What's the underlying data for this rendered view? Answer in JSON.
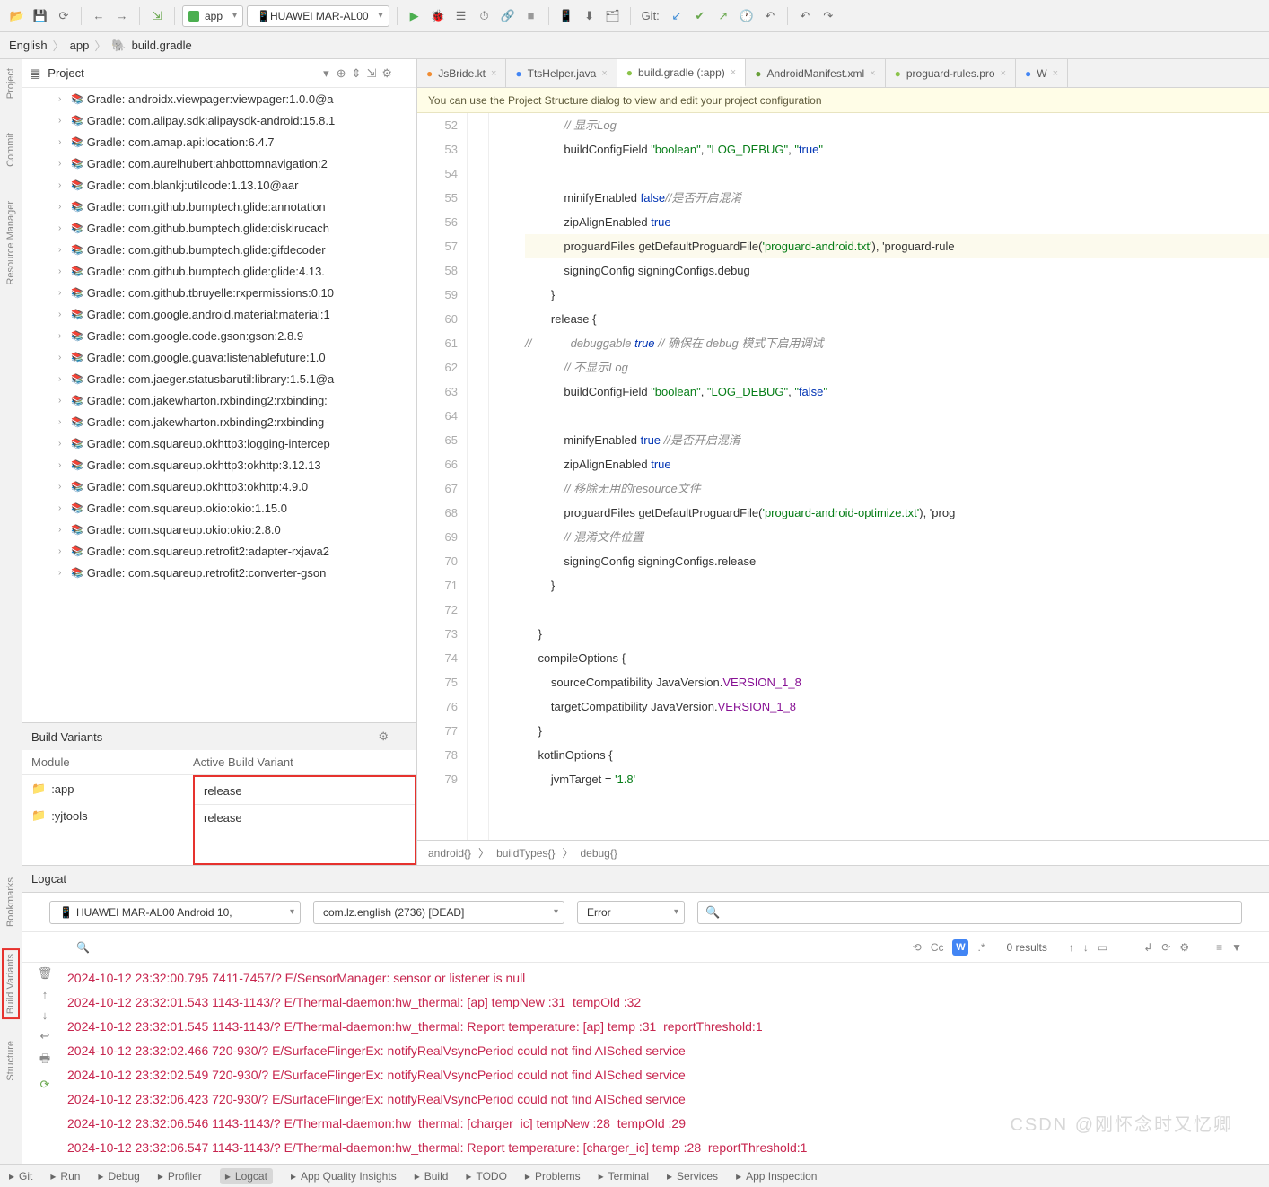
{
  "toolbar": {
    "run_config": "app",
    "device": "HUAWEI MAR-AL00",
    "vcs_label": "Git:"
  },
  "breadcrumb": {
    "root": "English",
    "mid": "app",
    "file": "build.gradle"
  },
  "left_rails": [
    "Project",
    "Commit",
    "Resource Manager"
  ],
  "project_panel": {
    "title": "Project"
  },
  "tree_items": [
    "Gradle: androidx.viewpager:viewpager:1.0.0@a",
    "Gradle: com.alipay.sdk:alipaysdk-android:15.8.1",
    "Gradle: com.amap.api:location:6.4.7",
    "Gradle: com.aurelhubert:ahbottomnavigation:2",
    "Gradle: com.blankj:utilcode:1.13.10@aar",
    "Gradle: com.github.bumptech.glide:annotation",
    "Gradle: com.github.bumptech.glide:disklrucach",
    "Gradle: com.github.bumptech.glide:gifdecoder",
    "Gradle: com.github.bumptech.glide:glide:4.13.",
    "Gradle: com.github.tbruyelle:rxpermissions:0.10",
    "Gradle: com.google.android.material:material:1",
    "Gradle: com.google.code.gson:gson:2.8.9",
    "Gradle: com.google.guava:listenablefuture:1.0",
    "Gradle: com.jaeger.statusbarutil:library:1.5.1@a",
    "Gradle: com.jakewharton.rxbinding2:rxbinding:",
    "Gradle: com.jakewharton.rxbinding2:rxbinding-",
    "Gradle: com.squareup.okhttp3:logging-intercep",
    "Gradle: com.squareup.okhttp3:okhttp:3.12.13",
    "Gradle: com.squareup.okhttp3:okhttp:4.9.0",
    "Gradle: com.squareup.okio:okio:1.15.0",
    "Gradle: com.squareup.okio:okio:2.8.0",
    "Gradle: com.squareup.retrofit2:adapter-rxjava2",
    "Gradle: com.squareup.retrofit2:converter-gson"
  ],
  "build_variants": {
    "title": "Build Variants",
    "col_module": "Module",
    "col_variant": "Active Build Variant",
    "rows": [
      {
        "module": ":app",
        "variant": "release"
      },
      {
        "module": ":yjtools",
        "variant": "release"
      }
    ]
  },
  "tabs": [
    {
      "label": "JsBride.kt",
      "color": "#f08c32"
    },
    {
      "label": "TtsHelper.java",
      "color": "#4285f4"
    },
    {
      "label": "build.gradle (:app)",
      "color": "#8bc34a",
      "active": true
    },
    {
      "label": "AndroidManifest.xml",
      "color": "#689f38"
    },
    {
      "label": "proguard-rules.pro",
      "color": "#8bc34a"
    },
    {
      "label": "W",
      "color": "#4285f4"
    }
  ],
  "hint": "You can use the Project Structure dialog to view and edit your project configuration",
  "code": {
    "start": 52,
    "lines": [
      "            // 显示Log",
      "            buildConfigField \"boolean\", \"LOG_DEBUG\", \"true\"",
      "",
      "            minifyEnabled false//是否开启混淆",
      "            zipAlignEnabled true",
      "            proguardFiles getDefaultProguardFile('proguard-android.txt'), 'proguard-rule",
      "            signingConfig signingConfigs.debug",
      "        }",
      "        release {",
      "//            debuggable true // 确保在 debug 模式下启用调试",
      "            // 不显示Log",
      "            buildConfigField \"boolean\", \"LOG_DEBUG\", \"false\"",
      "",
      "            minifyEnabled true //是否开启混淆",
      "            zipAlignEnabled true",
      "            // 移除无用的resource文件",
      "            proguardFiles getDefaultProguardFile('proguard-android-optimize.txt'), 'prog",
      "            // 混淆文件位置",
      "            signingConfig signingConfigs.release",
      "        }",
      "",
      "    }",
      "    compileOptions {",
      "        sourceCompatibility JavaVersion.VERSION_1_8",
      "        targetCompatibility JavaVersion.VERSION_1_8",
      "    }",
      "    kotlinOptions {",
      "        jvmTarget = '1.8'"
    ]
  },
  "editor_breadcrumb": [
    "android{}",
    "buildTypes{}",
    "debug{}"
  ],
  "logcat": {
    "title": "Logcat",
    "device": "HUAWEI MAR-AL00 Android 10,",
    "process": "com.lz.english (2736) [DEAD]",
    "level": "Error",
    "results": "0 results",
    "lines": [
      "2024-10-12 23:32:00.795 7411-7457/? E/SensorManager: sensor or listener is null",
      "2024-10-12 23:32:01.543 1143-1143/? E/Thermal-daemon:hw_thermal: [ap] tempNew :31  tempOld :32",
      "2024-10-12 23:32:01.545 1143-1143/? E/Thermal-daemon:hw_thermal: Report temperature: [ap] temp :31  reportThreshold:1",
      "2024-10-12 23:32:02.466 720-930/? E/SurfaceFlingerEx: notifyRealVsyncPeriod could not find AISched service",
      "2024-10-12 23:32:02.549 720-930/? E/SurfaceFlingerEx: notifyRealVsyncPeriod could not find AISched service",
      "2024-10-12 23:32:06.423 720-930/? E/SurfaceFlingerEx: notifyRealVsyncPeriod could not find AISched service",
      "2024-10-12 23:32:06.546 1143-1143/? E/Thermal-daemon:hw_thermal: [charger_ic] tempNew :28  tempOld :29",
      "2024-10-12 23:32:06.547 1143-1143/? E/Thermal-daemon:hw_thermal: Report temperature: [charger_ic] temp :28  reportThreshold:1"
    ]
  },
  "left_rails_bottom": [
    "Bookmarks",
    "Build Variants",
    "Structure"
  ],
  "status_items": [
    "Git",
    "Run",
    "Debug",
    "Profiler",
    "Logcat",
    "App Quality Insights",
    "Build",
    "TODO",
    "Problems",
    "Terminal",
    "Services",
    "App Inspection"
  ],
  "watermark": "CSDN @刚怀念时又忆卿"
}
